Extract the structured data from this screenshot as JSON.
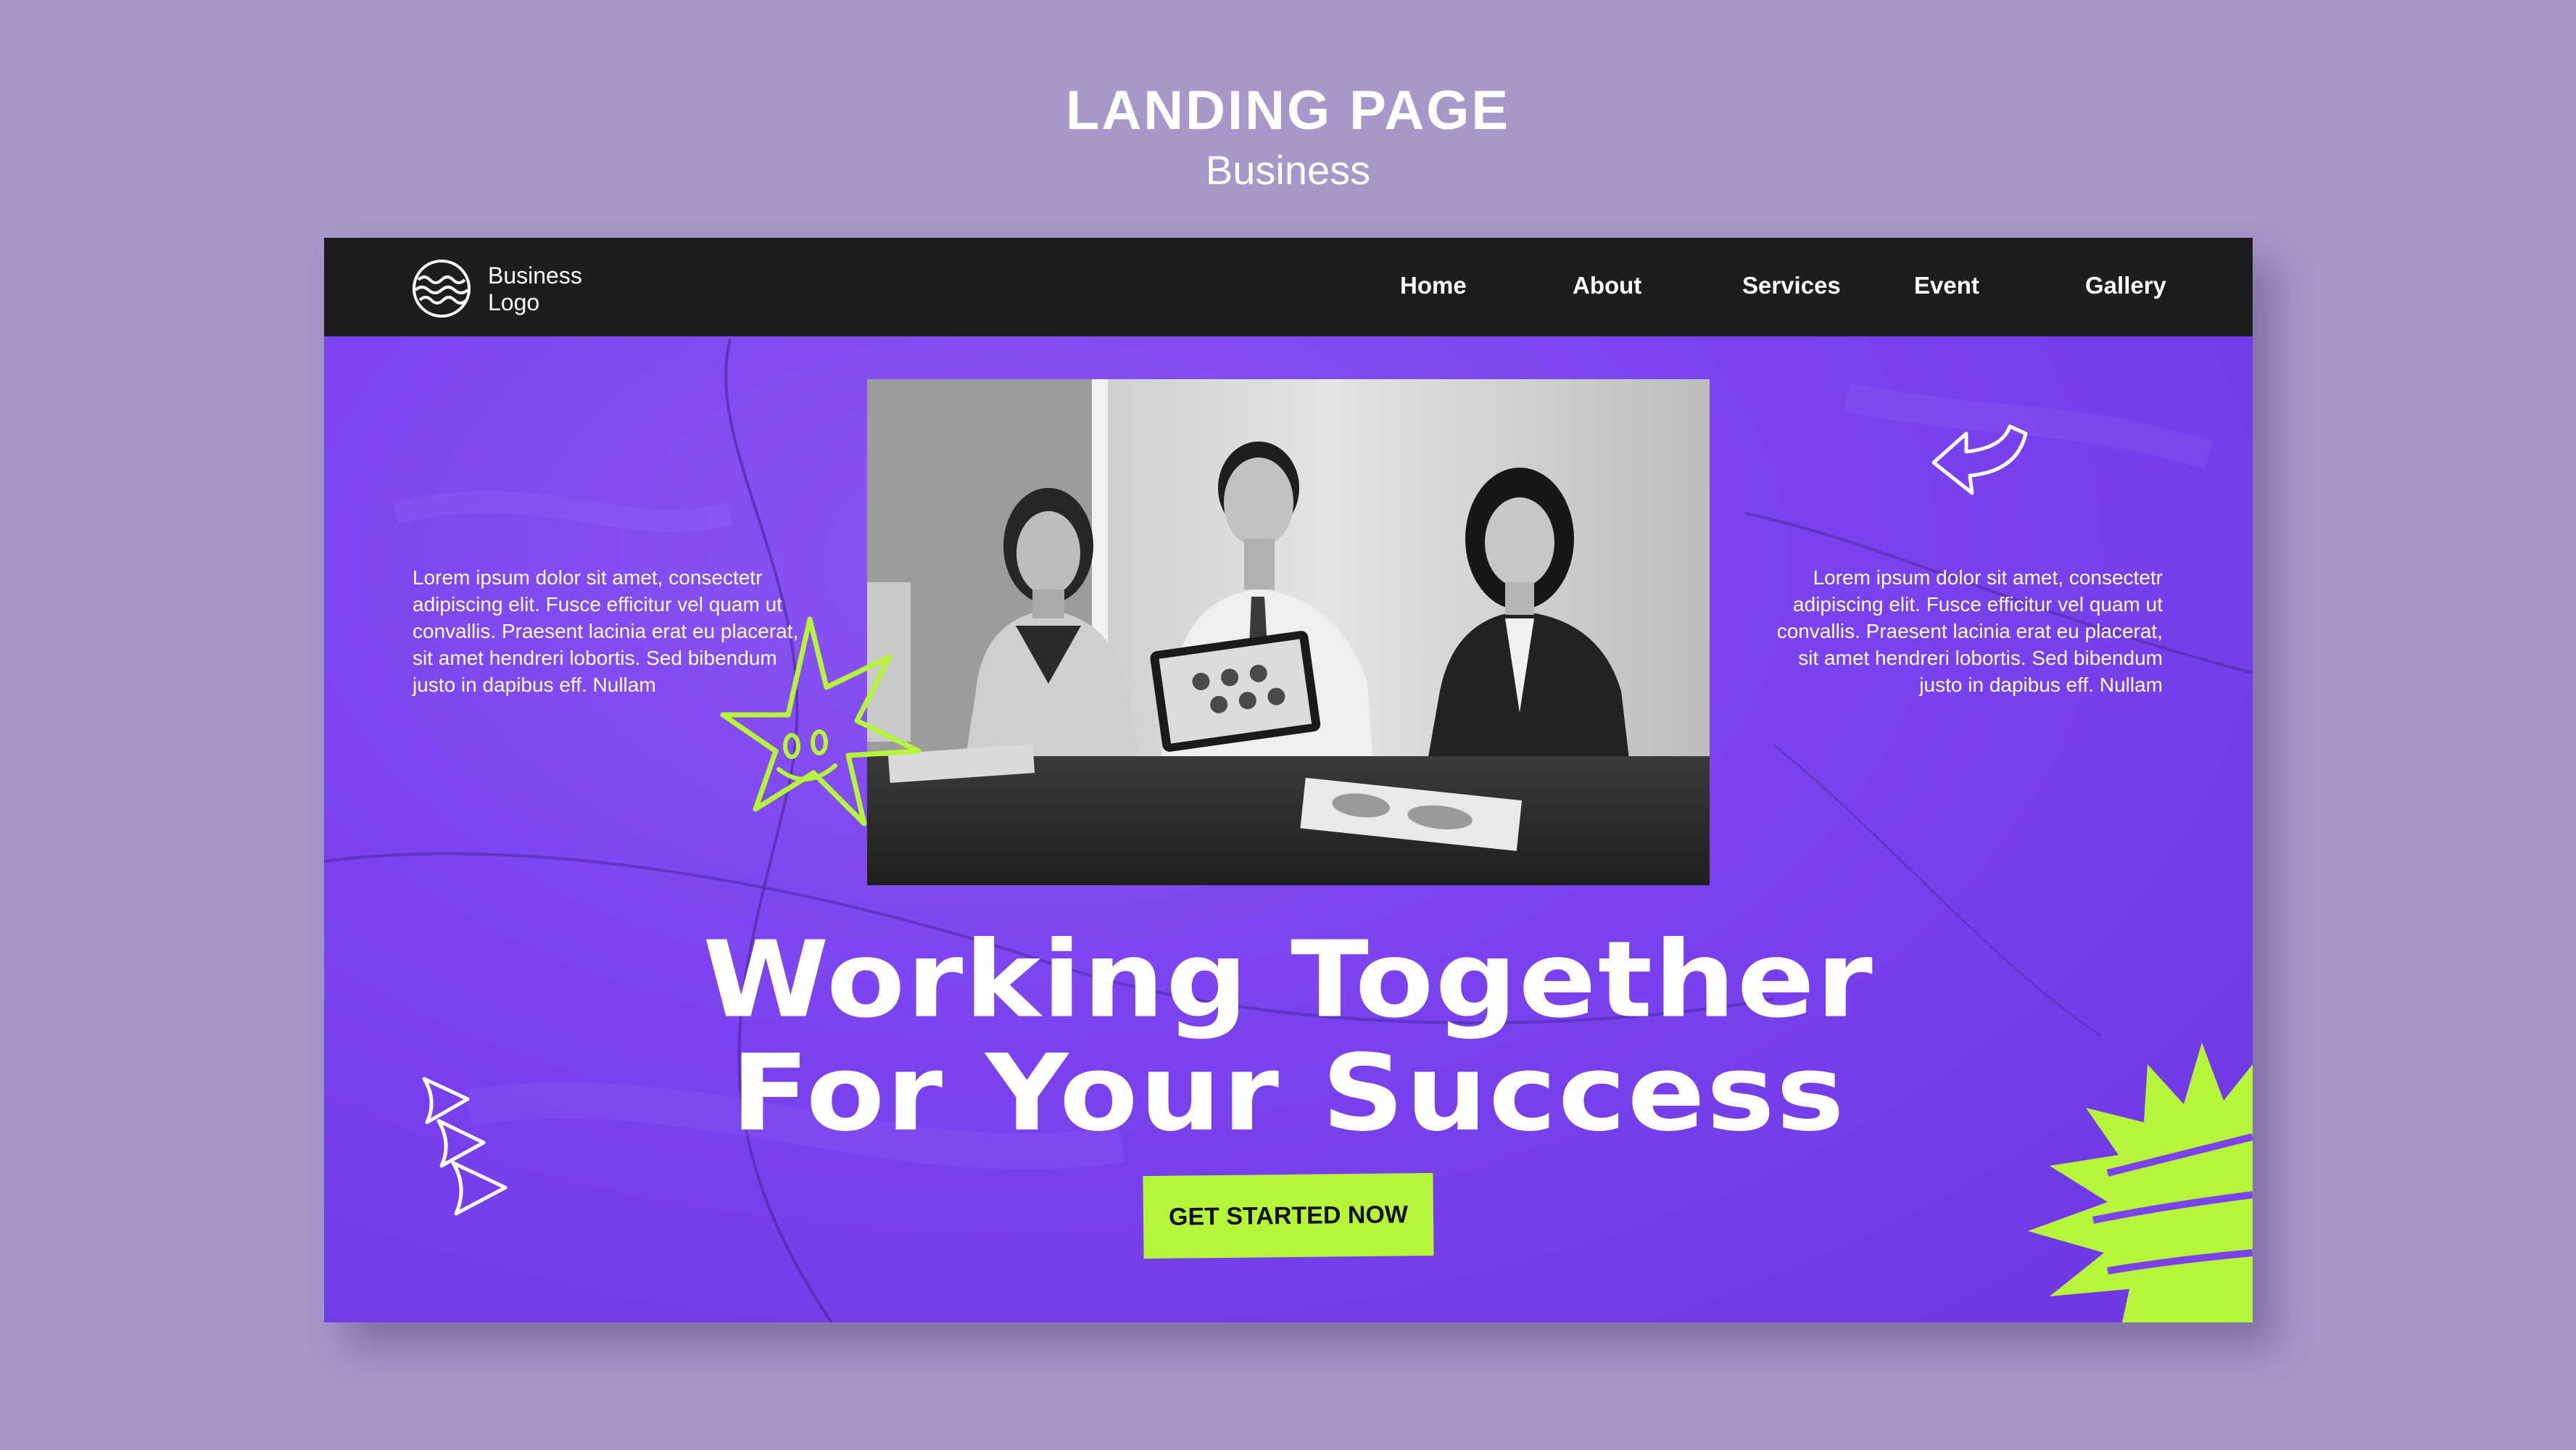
{
  "caption": {
    "title": "LANDING PAGE",
    "subtitle": "Business"
  },
  "navbar": {
    "logo": {
      "icon": "wavy-circle-logo-icon",
      "line1": "Business",
      "line2": "Logo"
    },
    "items": [
      {
        "label": "Home"
      },
      {
        "label": "About"
      },
      {
        "label": "Services"
      },
      {
        "label": "Event"
      },
      {
        "label": "Gallery"
      }
    ]
  },
  "hero": {
    "image": "grayscale photo of three smiling business people at a table holding a tablet",
    "left_text": "Lorem ipsum dolor sit amet, consectetr adipiscing elit. Fusce efficitur vel quam ut convallis. Praesent lacinia erat eu placerat, sit amet hendreri lobortis. Sed bibendum justo in dapibus eff. Nullam",
    "right_text": "Lorem ipsum dolor sit amet, consectetr adipiscing elit. Fusce efficitur vel quam ut convallis. Praesent lacinia erat eu placerat, sit amet hendreri lobortis. Sed bibendum justo in dapibus eff. Nullam",
    "headline_line1": "Working Together",
    "headline_line2": "For Your Success",
    "cta_label": "GET STARTED NOW"
  },
  "decorations": {
    "icons": [
      "curved-arrow-icon",
      "smiley-star-icon",
      "triangle-chevrons-icon",
      "spiky-burst-shape"
    ]
  },
  "colors": {
    "page_background": "#a897c9",
    "hero_purple": "#7a43ef",
    "navbar": "#1d1d1f",
    "accent_lime": "#b7f53a",
    "text": "#ffffff"
  }
}
